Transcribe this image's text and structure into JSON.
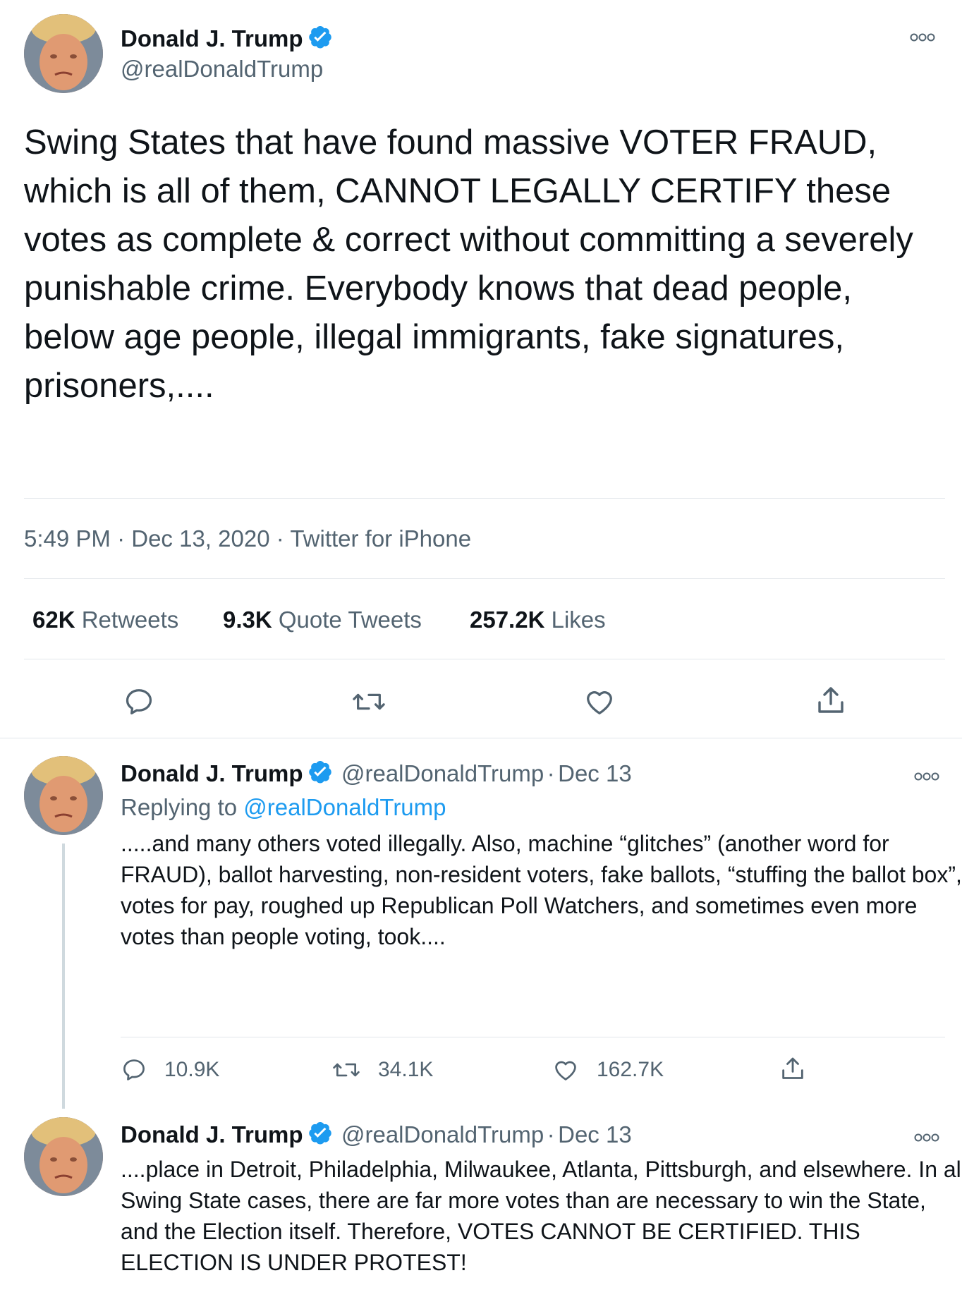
{
  "main_tweet": {
    "author": {
      "name": "Donald J. Trump",
      "handle": "@realDonaldTrump"
    },
    "text": "Swing States that have found massive VOTER FRAUD, which is all of them, CANNOT LEGALLY CERTIFY these votes as complete & correct without committing a severely punishable crime. Everybody knows that dead people, below age people, illegal immigrants, fake signatures, prisoners,....",
    "meta": {
      "time": "5:49 PM",
      "date": "Dec 13, 2020",
      "source": "Twitter for iPhone",
      "sep": "·"
    },
    "stats": {
      "retweets": {
        "value": "62K",
        "label": "Retweets"
      },
      "quotes": {
        "value": "9.3K",
        "label": "Quote Tweets"
      },
      "likes": {
        "value": "257.2K",
        "label": "Likes"
      }
    }
  },
  "replies": [
    {
      "author": {
        "name": "Donald J. Trump",
        "handle": "@realDonaldTrump",
        "date": "Dec 13"
      },
      "sep": "·",
      "replying_prefix": "Replying to",
      "replying_handle": "@realDonaldTrump",
      "text": ".....and many others voted illegally. Also, machine “glitches” (another word for FRAUD), ballot harvesting, non-resident voters, fake ballots, “stuffing the ballot box”, votes for pay, roughed up Republican Poll Watchers, and sometimes even more votes than people voting, took....",
      "counts": {
        "replies": "10.9K",
        "retweets": "34.1K",
        "likes": "162.7K"
      }
    },
    {
      "author": {
        "name": "Donald J. Trump",
        "handle": "@realDonaldTrump",
        "date": "Dec 13"
      },
      "sep": "·",
      "text": "....place in Detroit, Philadelphia, Milwaukee, Atlanta, Pittsburgh, and elsewhere. In all Swing State cases, there are far more votes than are necessary to win the State, and the Election itself. Therefore, VOTES CANNOT BE CERTIFIED. THIS ELECTION IS UNDER PROTEST!"
    }
  ],
  "icons": {
    "more": "more-icon",
    "verified": "verified-badge-icon",
    "reply": "reply-icon",
    "retweet": "retweet-icon",
    "like": "heart-icon",
    "share": "share-icon"
  },
  "colors": {
    "accent": "#1d9bf0",
    "secondary_text": "#536471",
    "text": "#0f1419",
    "divider": "#e1e6ea"
  }
}
